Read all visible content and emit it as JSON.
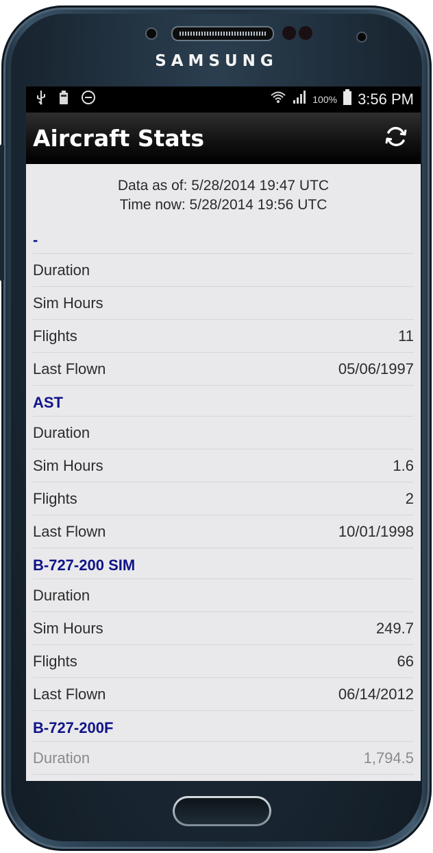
{
  "device": {
    "brand": "SAMSUNG"
  },
  "statusbar": {
    "icons_left": [
      "usb-icon",
      "battery-saver-icon",
      "do-not-disturb-icon"
    ],
    "icons_right": [
      "wifi-icon",
      "signal-icon",
      "battery-icon"
    ],
    "battery": "100%",
    "time": "3:56 PM"
  },
  "appbar": {
    "title": "Aircraft Stats",
    "refresh_icon": "refresh-icon"
  },
  "meta": {
    "data_as_of": "Data as of: 5/28/2014 19:47 UTC",
    "time_now": "Time now: 5/28/2014 19:56 UTC"
  },
  "aircraft": [
    {
      "name": "-",
      "rows": [
        {
          "label": "Duration",
          "value": ""
        },
        {
          "label": "Sim Hours",
          "value": ""
        },
        {
          "label": "Flights",
          "value": "11"
        },
        {
          "label": "Last Flown",
          "value": "05/06/1997"
        }
      ]
    },
    {
      "name": "AST",
      "rows": [
        {
          "label": "Duration",
          "value": ""
        },
        {
          "label": "Sim Hours",
          "value": "1.6"
        },
        {
          "label": "Flights",
          "value": "2"
        },
        {
          "label": "Last Flown",
          "value": "10/01/1998"
        }
      ]
    },
    {
      "name": "B-727-200 SIM",
      "rows": [
        {
          "label": "Duration",
          "value": ""
        },
        {
          "label": "Sim Hours",
          "value": "249.7"
        },
        {
          "label": "Flights",
          "value": "66"
        },
        {
          "label": "Last Flown",
          "value": "06/14/2012"
        }
      ]
    },
    {
      "name": "B-727-200F",
      "rows": [
        {
          "label": "Duration",
          "value": "1,794.5"
        }
      ]
    }
  ],
  "colors": {
    "header_text": "#0f1487",
    "screen_bg": "#e9e9ec",
    "appbar_bg": "#000000"
  }
}
